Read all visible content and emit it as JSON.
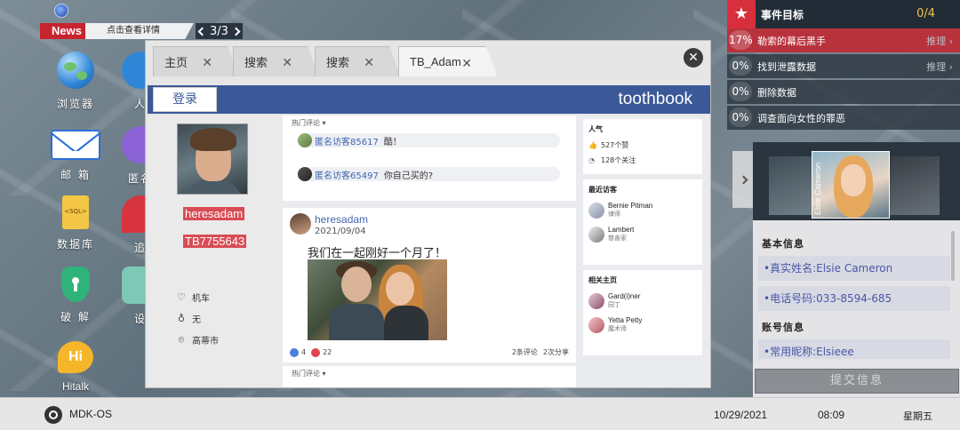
{
  "news": {
    "label": "News",
    "link": "点击查看详情",
    "pager": "3/3"
  },
  "desktop_icons": [
    {
      "name": "browser",
      "label": "浏览器"
    },
    {
      "name": "mail",
      "label": "邮 箱"
    },
    {
      "name": "database",
      "label": "数据库"
    },
    {
      "name": "crack",
      "label": "破 解"
    },
    {
      "name": "hitalk",
      "label": "Hitalk",
      "glyph": "Hi"
    },
    {
      "name": "partial-1",
      "label": "人"
    },
    {
      "name": "partial-2",
      "label": "匿名"
    },
    {
      "name": "partial-3",
      "label": "追"
    },
    {
      "name": "partial-4",
      "label": "设"
    }
  ],
  "browser": {
    "tabs": [
      {
        "label": "主页"
      },
      {
        "label": "搜索"
      },
      {
        "label": "搜索"
      },
      {
        "label": "TB_Adam"
      }
    ],
    "login": "登录",
    "brand": "toothbook",
    "profile": {
      "username": "heresadam",
      "id": "TB7755643",
      "info": [
        {
          "icon": "heart-icon",
          "glyph": "♡",
          "text": "机车"
        },
        {
          "icon": "tie-icon",
          "glyph": "♁",
          "text": "无"
        },
        {
          "icon": "location-icon",
          "glyph": "⌾",
          "text": "高蒂市"
        }
      ]
    },
    "feed": {
      "hot_comments_label": "热门评论",
      "top_comments": [
        {
          "who": "匿名访客85617",
          "text": "酷！"
        },
        {
          "who": "匿名访客65497",
          "text": "你自己买的?"
        }
      ],
      "post": {
        "author": "heresadam",
        "date": "2021/09/04",
        "text": "我们在一起刚好一个月了！",
        "likes": "4",
        "hearts": "22",
        "comments": "2条评论",
        "shares": "2次分享"
      },
      "bottom_label": "热门评论"
    },
    "sidebar": {
      "popularity_title": "人气",
      "likes": "527个赞",
      "follows": "128个关注",
      "visitors_title": "最近访客",
      "visitors": [
        {
          "name": "Bernie Pitman",
          "role": "律师"
        },
        {
          "name": "Lambert",
          "role": "慈善家"
        }
      ],
      "related_title": "相关主页",
      "related": [
        {
          "name": "Gard(i)ner",
          "role": "园丁"
        },
        {
          "name": "Yetta Petty",
          "role": "魔术师"
        }
      ]
    }
  },
  "objectives": {
    "title": "事件目标",
    "count": "0/4",
    "items": [
      {
        "pct": "17%",
        "text": "勒索的幕后黑手",
        "hint": "推理",
        "active": true
      },
      {
        "pct": "0%",
        "text": "找到泄露数据",
        "hint": "推理",
        "active": false
      },
      {
        "pct": "0%",
        "text": "删除数据",
        "hint": "",
        "active": false
      },
      {
        "pct": "0%",
        "text": "调查面向女性的罪恶",
        "hint": "",
        "active": false
      }
    ]
  },
  "contact": {
    "card_name": "Elsie Cameron",
    "basic_label": "基本信息",
    "real_name": "•真实姓名:Elsie Cameron",
    "phone": "•电话号码:033-8594-685",
    "account_label": "账号信息",
    "nickname": "•常用昵称:Elsieee",
    "submit": "提交信息"
  },
  "taskbar": {
    "os": "MDK-OS",
    "date": "10/29/2021",
    "time": "08:09",
    "day": "星期五"
  },
  "colors": {
    "brand_blue": "#3b5998",
    "accent_red": "#d82f3c",
    "highlight_red": "#d94c55"
  }
}
